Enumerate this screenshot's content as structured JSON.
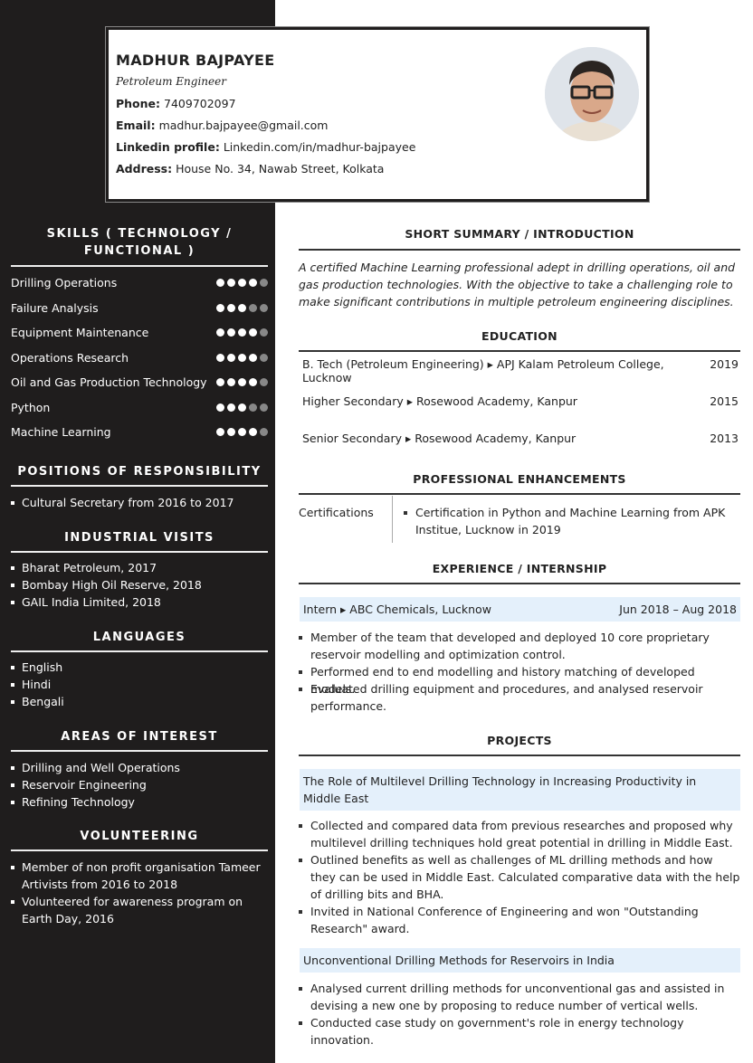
{
  "header": {
    "name": "MADHUR BAJPAYEE",
    "title": "Petroleum Engineer",
    "phone_label": "Phone:",
    "phone": "7409702097",
    "email_label": "Email:",
    "email": "madhur.bajpayee@gmail.com",
    "linkedin_label": "Linkedin profile:",
    "linkedin": "Linkedin.com/in/madhur-bajpayee",
    "address_label": "Address:",
    "address": "House No. 34, Nawab Street, Kolkata"
  },
  "sidebar": {
    "skills_heading": "SKILLS ( TECHNOLOGY / FUNCTIONAL )",
    "skills": [
      {
        "name": "Drilling Operations",
        "level": 4,
        "max": 5
      },
      {
        "name": "Failure Analysis",
        "level": 3,
        "max": 5
      },
      {
        "name": "Equipment Maintenance",
        "level": 4,
        "max": 5
      },
      {
        "name": "Operations Research",
        "level": 4,
        "max": 5
      },
      {
        "name": "Oil and Gas Production Technology",
        "level": 4,
        "max": 5
      },
      {
        "name": "Python",
        "level": 3,
        "max": 5
      },
      {
        "name": "Machine Learning",
        "level": 4,
        "max": 5
      }
    ],
    "positions_heading": "POSITIONS OF RESPONSIBILITY",
    "positions": [
      "Cultural Secretary from 2016 to 2017"
    ],
    "visits_heading": "INDUSTRIAL VISITS",
    "visits": [
      "Bharat Petroleum, 2017",
      "Bombay High Oil Reserve, 2018",
      "GAIL India Limited, 2018"
    ],
    "languages_heading": "LANGUAGES",
    "languages": [
      "English",
      "Hindi",
      "Bengali"
    ],
    "interests_heading": "AREAS OF INTEREST",
    "interests": [
      "Drilling and Well Operations",
      "Reservoir Engineering",
      "Refining Technology"
    ],
    "volunteering_heading": "VOLUNTEERING",
    "volunteering": [
      "Member of non profit organisation Tameer Artivists from 2016 to 2018",
      "Volunteered for awareness program on Earth Day, 2016"
    ]
  },
  "main": {
    "summary_heading": "SHORT SUMMARY / INTRODUCTION",
    "summary": "A certified Machine Learning professional adept in drilling operations, oil and gas production technologies. With the objective to take a challenging role to make significant contributions in multiple petroleum engineering disciplines.",
    "education_heading": "EDUCATION",
    "education": [
      {
        "degree": "B. Tech (Petroleum Engineering)",
        "school": "APJ Kalam Petroleum College, Lucknow",
        "year": "2019"
      },
      {
        "degree": "Higher Secondary",
        "school": "Rosewood Academy, Kanpur",
        "year": "2015"
      },
      {
        "degree": "Senior Secondary",
        "school": "Rosewood Academy, Kanpur",
        "year": "2013"
      }
    ],
    "enh_heading": "PROFESSIONAL ENHANCEMENTS",
    "cert_label": "Certifications",
    "certs": [
      "Certification in Python and Machine Learning from APK Institue, Lucknow in 2019"
    ],
    "exp_heading": "EXPERIENCE / INTERNSHIP",
    "exp": {
      "role": "Intern",
      "company": "ABC Chemicals, Lucknow",
      "dates": "Jun 2018 – Aug 2018",
      "bullets": [
        "Member of the team that developed and deployed 10 core proprietary reservoir modelling and optimization control.",
        "Performed end to end modelling and history matching of developed models.",
        "Evaluated drilling equipment and procedures, and analysed reservoir performance."
      ]
    },
    "projects_heading": "PROJECTS",
    "projects": [
      {
        "title": "The Role of Multilevel Drilling Technology in Increasing Productivity in Middle East",
        "bullets": [
          "Collected and compared data from previous researches and proposed why multilevel drilling techniques hold great potential in drilling in Middle East.",
          "Outlined benefits as well as challenges of ML drilling methods and how they can be used in Middle East. Calculated comparative data with the help of drilling bits and BHA.",
          "Invited in National Conference of Engineering and won \"Outstanding Research\" award."
        ]
      },
      {
        "title": "Unconventional Drilling Methods for Reservoirs in India",
        "bullets": [
          "Analysed current drilling methods for unconventional gas and assisted in devising a new one by proposing to reduce number of vertical wells.",
          "Conducted case study on government's role in energy technology innovation."
        ]
      }
    ]
  }
}
